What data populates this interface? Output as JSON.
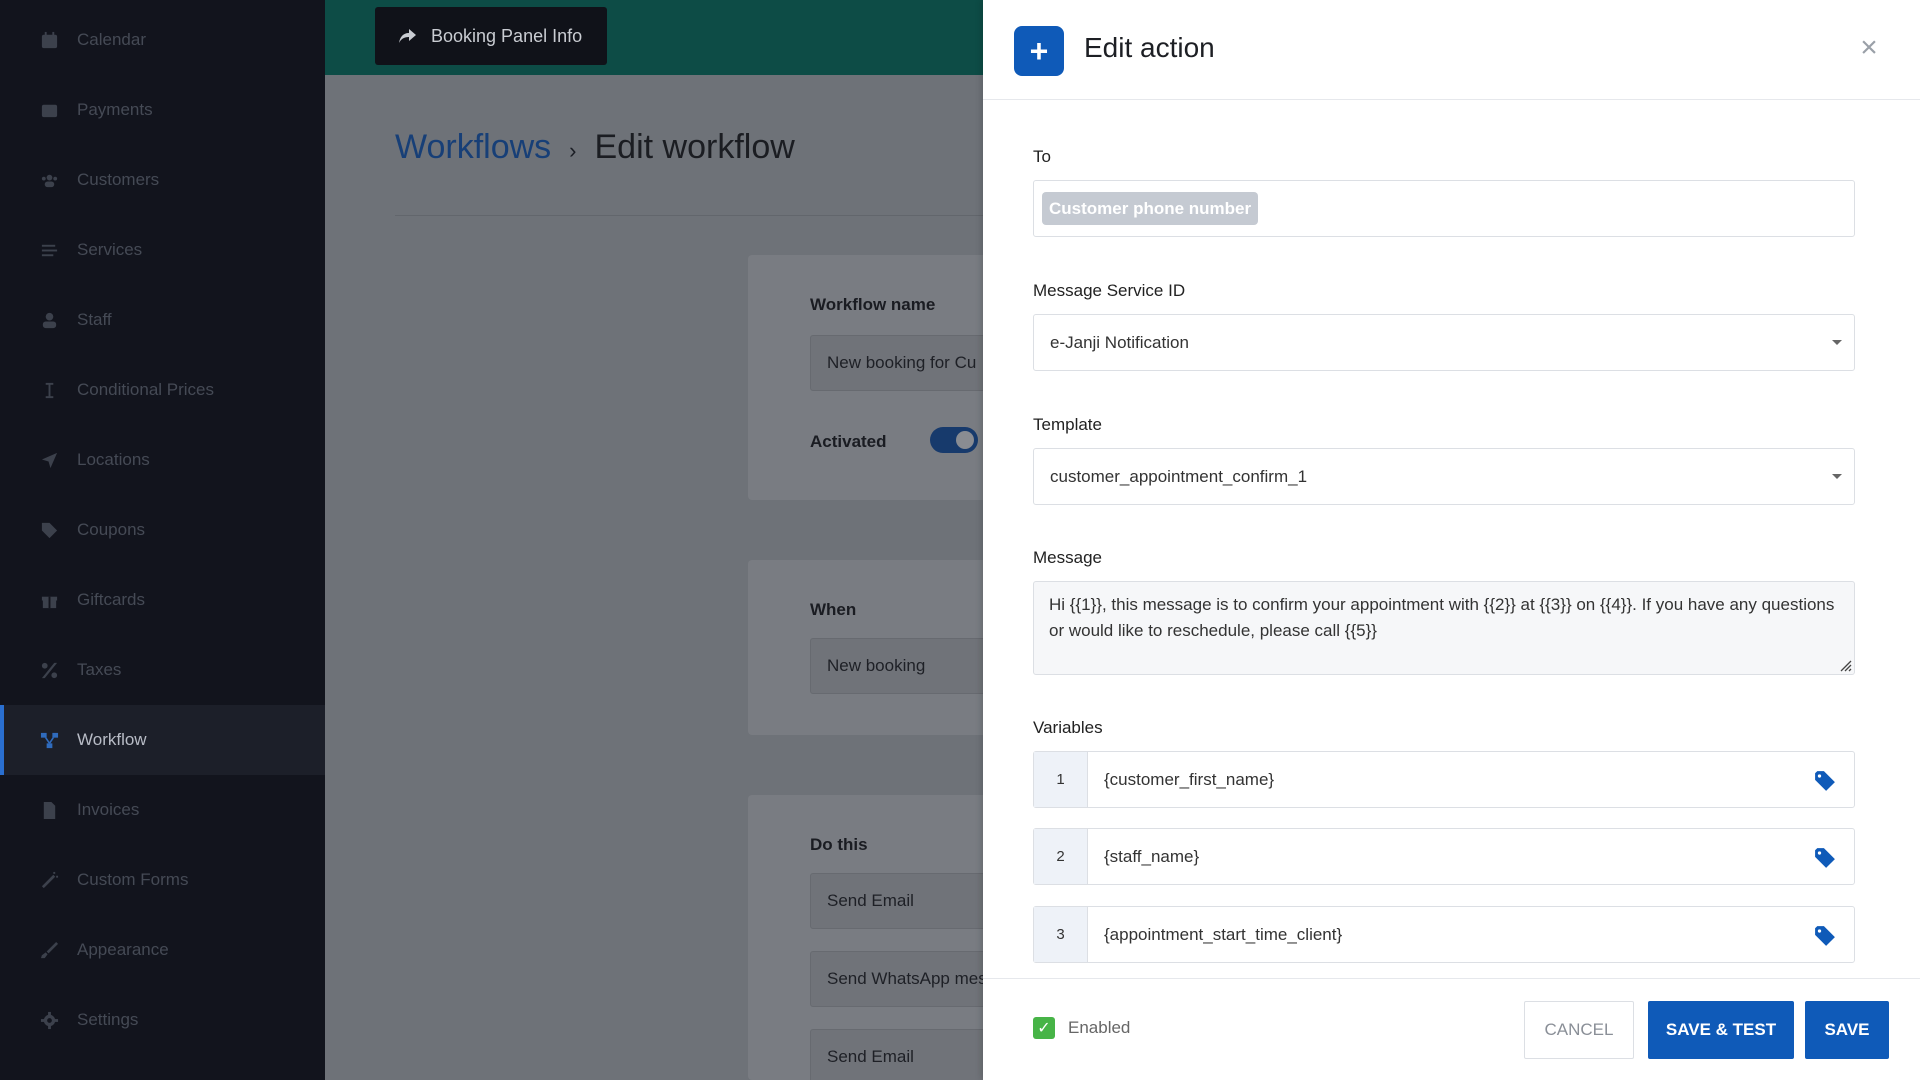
{
  "sidebar": {
    "items": [
      {
        "label": "Calendar",
        "icon": "calendar-icon"
      },
      {
        "label": "Payments",
        "icon": "wallet-icon"
      },
      {
        "label": "Customers",
        "icon": "users-icon"
      },
      {
        "label": "Services",
        "icon": "list-icon"
      },
      {
        "label": "Staff",
        "icon": "user-icon"
      },
      {
        "label": "Conditional Prices",
        "icon": "i-cursor-icon"
      },
      {
        "label": "Locations",
        "icon": "location-arrow-icon"
      },
      {
        "label": "Coupons",
        "icon": "tag-icon"
      },
      {
        "label": "Giftcards",
        "icon": "gift-icon"
      },
      {
        "label": "Taxes",
        "icon": "percent-icon"
      },
      {
        "label": "Workflow",
        "icon": "sitemap-icon"
      },
      {
        "label": "Invoices",
        "icon": "file-icon"
      },
      {
        "label": "Custom Forms",
        "icon": "magic-wand-icon"
      },
      {
        "label": "Appearance",
        "icon": "brush-icon"
      },
      {
        "label": "Settings",
        "icon": "gear-icon"
      }
    ],
    "active": "Workflow"
  },
  "topbar": {
    "booking_panel_label": "Booking Panel Info"
  },
  "breadcrumb": {
    "link": "Workflows",
    "separator": "›",
    "current": "Edit workflow"
  },
  "workflow_card": {
    "name_label": "Workflow name",
    "name_value": "New booking for Cu",
    "activated_label": "Activated",
    "activated": true
  },
  "when_card": {
    "label": "When",
    "value": "New booking"
  },
  "do_card": {
    "label": "Do this",
    "actions": [
      "Send Email",
      "Send WhatsApp mes",
      "Send Email"
    ]
  },
  "drawer": {
    "title": "Edit action",
    "plus_symbol": "+",
    "close_symbol": "×",
    "to_label": "To",
    "to_chip": "Customer phone number",
    "service_label": "Message Service ID",
    "service_value": "e-Janji Notification",
    "template_label": "Template",
    "template_value": "customer_appointment_confirm_1",
    "message_label": "Message",
    "message_value": "Hi {{1}}, this message is to confirm your appointment with {{2}} at {{3}} on {{4}}. If you have any questions or would like to reschedule, please call {{5}}",
    "variables_label": "Variables",
    "variables": [
      {
        "num": "1",
        "value": "{customer_first_name}"
      },
      {
        "num": "2",
        "value": "{staff_name}"
      },
      {
        "num": "3",
        "value": "{appointment_start_time_client}"
      }
    ],
    "enabled_label": "Enabled",
    "enabled": true,
    "cancel_label": "CANCEL",
    "save_test_label": "SAVE & TEST",
    "save_label": "SAVE"
  },
  "colors": {
    "accent": "#0f5ab8",
    "sidebar_bg": "#12141d",
    "topbar": "#0d4c46",
    "check": "#47b447"
  }
}
